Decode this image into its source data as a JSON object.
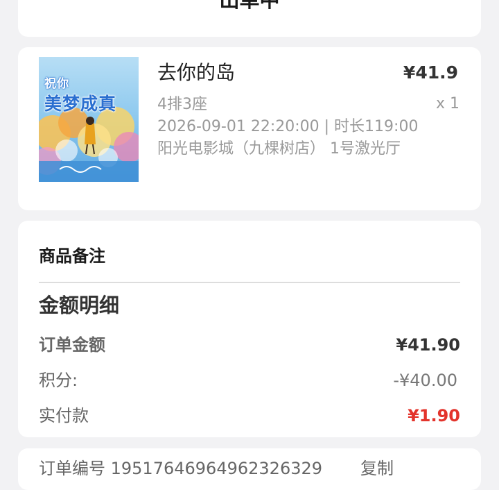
{
  "status": {
    "title": "出单中"
  },
  "order": {
    "poster_line1": "祝你",
    "poster_line2": "美梦成真",
    "movie_title": "去你的岛",
    "price": "¥41.9",
    "quantity": "x 1",
    "seat": "4排3座",
    "showtime": "2026-09-01 22:20:00 | 时长119:00",
    "cinema": "阳光电影城（九棵树店） 1号激光厅"
  },
  "detail": {
    "remark_label": "商品备注",
    "amount_title": "金额明细",
    "order_amount_label": "订单金额",
    "order_amount_value": "¥41.90",
    "points_label": "积分:",
    "points_value": "-¥40.00",
    "paid_label": "实付款",
    "paid_value": "¥1.90"
  },
  "bottom": {
    "order_no_text": "订单编号    19517646964962326329",
    "copy_label": "复制"
  },
  "colors": {
    "background": "#f2f2f4",
    "card": "#ffffff",
    "paid_accent": "#e3342c",
    "poster_blue": "#2a6fd0"
  }
}
